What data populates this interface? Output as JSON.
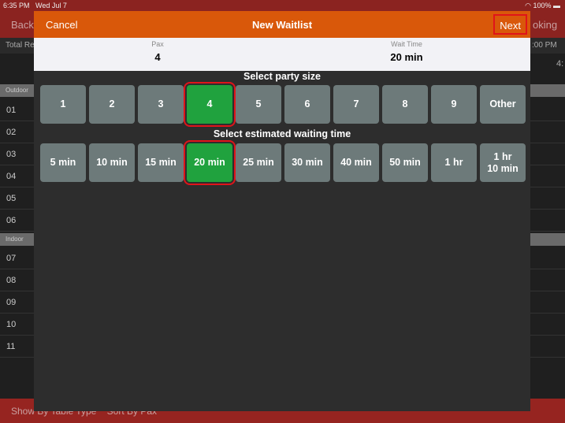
{
  "status": {
    "time": "6:35 PM",
    "date": "Wed Jul 7",
    "battery": "100%"
  },
  "background": {
    "back": "Back",
    "right": "oking",
    "total": "Total Re",
    "time_col": ":00 PM",
    "time_col2": "4:",
    "sections": [
      "Outdoor",
      "Indoor"
    ],
    "outdoor_rows": [
      "01",
      "02",
      "03",
      "04",
      "05",
      "06"
    ],
    "indoor_rows": [
      "07",
      "08",
      "09",
      "10",
      "11"
    ],
    "bottom": [
      "Show By Table Type",
      "Sort By Pax"
    ]
  },
  "modal": {
    "cancel": "Cancel",
    "title": "New Waitlist",
    "next": "Next",
    "pax_label": "Pax",
    "pax_value": "4",
    "wait_label": "Wait Time",
    "wait_value": "20 min",
    "party_heading": "Select party size",
    "party_options": [
      "1",
      "2",
      "3",
      "4",
      "5",
      "6",
      "7",
      "8",
      "9",
      "Other"
    ],
    "party_selected": "4",
    "wait_heading": "Select estimated waiting time",
    "wait_options": [
      "5 min",
      "10 min",
      "15 min",
      "20 min",
      "25 min",
      "30 min",
      "40 min",
      "50 min",
      "1 hr",
      "1 hr\n10 min"
    ],
    "wait_selected": "20 min",
    "accent": "#d9580a",
    "selected_color": "#20a23e"
  }
}
